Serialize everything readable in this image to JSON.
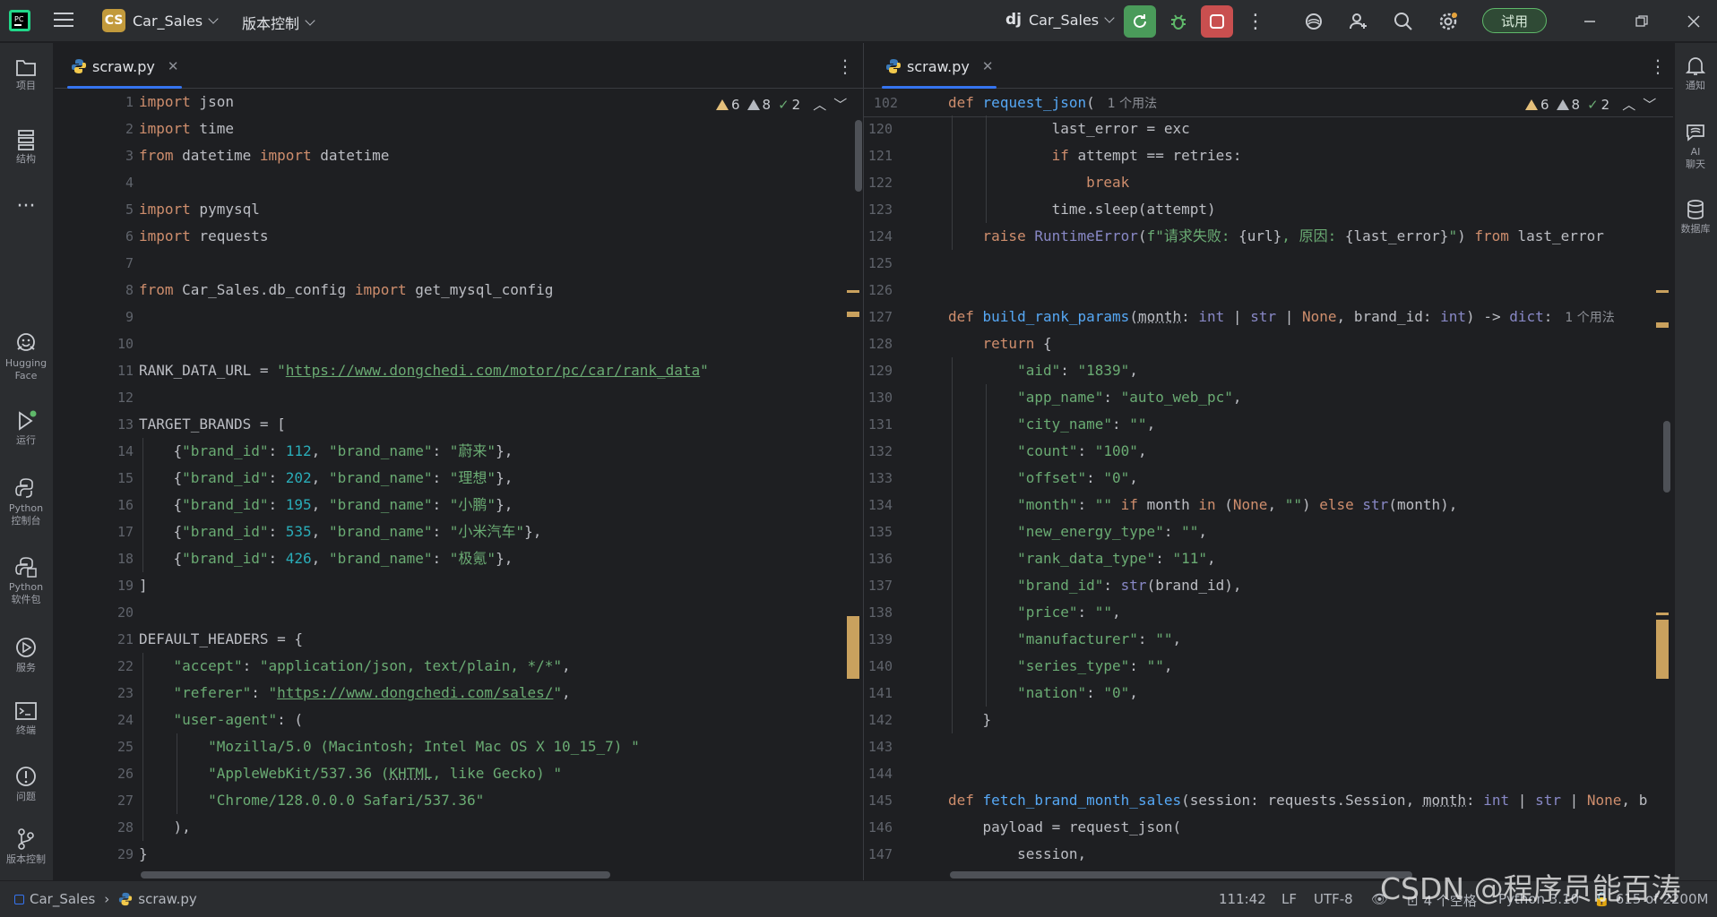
{
  "titlebar": {
    "project_badge": "CS",
    "project_name": "Car_Sales",
    "vcs_menu": "版本控制",
    "run_config_icon": "dj",
    "run_config": "Car_Sales",
    "trial_label": "试用"
  },
  "left_tools": [
    {
      "id": "project",
      "label": "项目"
    },
    {
      "id": "structure",
      "label": "结构"
    },
    {
      "id": "more",
      "label": ""
    },
    {
      "id": "hugging-face",
      "label": "Hugging\nFace"
    },
    {
      "id": "run",
      "label": "运行"
    },
    {
      "id": "python-console",
      "label": "Python\n控制台"
    },
    {
      "id": "python-packages",
      "label": "Python\n软件包"
    },
    {
      "id": "services",
      "label": "服务"
    },
    {
      "id": "terminal",
      "label": "终端"
    },
    {
      "id": "problems",
      "label": "问题"
    },
    {
      "id": "vcs",
      "label": "版本控制"
    }
  ],
  "right_tools": [
    {
      "id": "notifications",
      "label": "通知"
    },
    {
      "id": "ai-chat",
      "label": "AI\n聊天"
    },
    {
      "id": "database",
      "label": "数据库"
    }
  ],
  "left_editor": {
    "tab": "scraw.py",
    "inspections": {
      "warnings": "6",
      "weak_warnings": "8",
      "ok": "2"
    },
    "first_line": 1,
    "lines": [
      "<span class=\"kw\">import</span> json",
      "<span class=\"kw\">import</span> time",
      "<span class=\"kw\">from</span> datetime <span class=\"kw\">import</span> datetime",
      "",
      "<span class=\"kw\">import</span> pymysql",
      "<span class=\"kw\">import</span> requests",
      "",
      "<span class=\"kw\">from</span> Car_Sales.db_config <span class=\"kw\">import</span> get_mysql_config",
      "",
      "",
      "RANK_DATA_URL = <span class=\"str\">\"<span class=\"url\">https://www.dongchedi.com/motor/pc/car/rank_data</span>\"</span>",
      "",
      "TARGET_BRANDS = [",
      "    {<span class=\"str\">\"brand_id\"</span>: <span class=\"num\">112</span>, <span class=\"str\">\"brand_name\"</span>: <span class=\"str\">\"蔚来\"</span>},",
      "    {<span class=\"str\">\"brand_id\"</span>: <span class=\"num\">202</span>, <span class=\"str\">\"brand_name\"</span>: <span class=\"str\">\"理想\"</span>},",
      "    {<span class=\"str\">\"brand_id\"</span>: <span class=\"num\">195</span>, <span class=\"str\">\"brand_name\"</span>: <span class=\"str\">\"小鹏\"</span>},",
      "    {<span class=\"str\">\"brand_id\"</span>: <span class=\"num\">535</span>, <span class=\"str\">\"brand_name\"</span>: <span class=\"str\">\"小米汽车\"</span>},",
      "    {<span class=\"str\">\"brand_id\"</span>: <span class=\"num\">426</span>, <span class=\"str\">\"brand_name\"</span>: <span class=\"str\">\"极氪\"</span>},",
      "]",
      "",
      "DEFAULT_HEADERS = {",
      "    <span class=\"str\">\"accept\"</span>: <span class=\"str\">\"application/json, text/plain, */*\"</span>,",
      "    <span class=\"str\">\"referer\"</span>: <span class=\"str\">\"<span class=\"url\">https://www.dongchedi.com/sales/</span>\"</span>,",
      "    <span class=\"str\">\"user-agent\"</span>: (",
      "        <span class=\"str\">\"Mozilla/5.0 (Macintosh; Intel Mac OS X 10_15_7) \"</span>",
      "        <span class=\"str\">\"AppleWebKit/537.36 (<span class=\"prm\">KHTML</span>, like Gecko) \"</span>",
      "        <span class=\"str\">\"Chrome/128.0.0.0 Safari/537.36\"</span>",
      "    ),",
      "}"
    ]
  },
  "right_editor": {
    "tab": "scraw.py",
    "inspections": {
      "warnings": "6",
      "weak_warnings": "8",
      "ok": "2"
    },
    "sticky": {
      "line": "102",
      "code": "<span class=\"kw\">def</span> <span class=\"fn\">request_json</span>(<span class=\"hint\">1 个用法</span>"
    },
    "first_line": 120,
    "lines": [
      "            last_error = exc",
      "            <span class=\"kw\">if</span> attempt == retries:",
      "                <span class=\"kw\">break</span>",
      "            time.sleep(attempt)",
      "    <span class=\"kw\">raise</span> <span class=\"bi\">RuntimeError</span>(<span class=\"str\">f\"请求失败: </span>{url}<span class=\"str\">, 原因: </span>{last_error}<span class=\"str\">\"</span>) <span class=\"kw\">from</span> last_error",
      "",
      "",
      "<span class=\"kw\">def</span> <span class=\"fn\">build_rank_params</span>(<span class=\"prm\">month</span>: <span class=\"bi\">int</span> | <span class=\"bi\">str</span> | <span class=\"kw\">None</span>, brand_id: <span class=\"bi\">int</span>) -&gt; <span class=\"bi\">dict</span>:<span class=\"hint\">1 个用法</span>",
      "    <span class=\"kw\">return</span> {",
      "        <span class=\"str\">\"aid\"</span>: <span class=\"str\">\"1839\"</span>,",
      "        <span class=\"str\">\"app_name\"</span>: <span class=\"str\">\"auto_web_pc\"</span>,",
      "        <span class=\"str\">\"city_name\"</span>: <span class=\"str\">\"\"</span>,",
      "        <span class=\"str\">\"count\"</span>: <span class=\"str\">\"100\"</span>,",
      "        <span class=\"str\">\"offset\"</span>: <span class=\"str\">\"0\"</span>,",
      "        <span class=\"str\">\"month\"</span>: <span class=\"str\">\"\"</span> <span class=\"kw\">if</span> month <span class=\"kw\">in</span> (<span class=\"kw\">None</span>, <span class=\"str\">\"\"</span>) <span class=\"kw\">else</span> <span class=\"bi\">str</span>(month),",
      "        <span class=\"str\">\"new_energy_type\"</span>: <span class=\"str\">\"\"</span>,",
      "        <span class=\"str\">\"rank_data_type\"</span>: <span class=\"str\">\"11\"</span>,",
      "        <span class=\"str\">\"brand_id\"</span>: <span class=\"bi\">str</span>(brand_id),",
      "        <span class=\"str\">\"price\"</span>: <span class=\"str\">\"\"</span>,",
      "        <span class=\"str\">\"manufacturer\"</span>: <span class=\"str\">\"\"</span>,",
      "        <span class=\"str\">\"series_type\"</span>: <span class=\"str\">\"\"</span>,",
      "        <span class=\"str\">\"nation\"</span>: <span class=\"str\">\"0\"</span>,",
      "    }",
      "",
      "",
      "<span class=\"kw\">def</span> <span class=\"fn\">fetch_brand_month_sales</span>(session: requests.Session, <span class=\"prm\">month</span>: <span class=\"bi\">int</span> | <span class=\"bi\">str</span> | <span class=\"kw\">None</span>, b",
      "    payload = request_json(",
      "        session,"
    ]
  },
  "statusbar": {
    "breadcrumb_project": "Car_Sales",
    "breadcrumb_file": "scraw.py",
    "caret": "111:42",
    "line_sep": "LF",
    "encoding": "UTF-8",
    "indent": "4 个空格",
    "interpreter": "Python 3.10",
    "memory": "615 of 2200M"
  },
  "watermark": "CSDN @程序员能百涛"
}
